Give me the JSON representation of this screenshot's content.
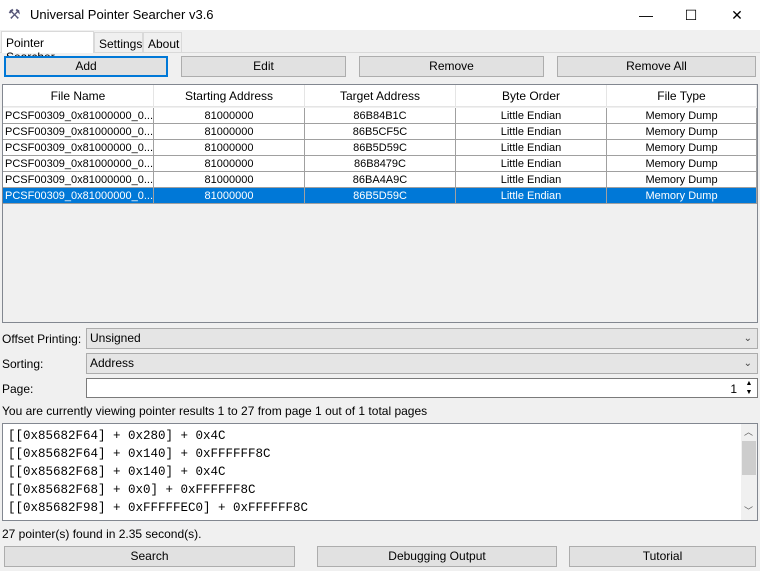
{
  "window": {
    "title": "Universal Pointer Searcher v3.6",
    "minimize": "—",
    "maximize": "☐",
    "close": "✕"
  },
  "tabs": [
    {
      "label": "Pointer Searcher"
    },
    {
      "label": "Settings"
    },
    {
      "label": "About"
    }
  ],
  "toolbar": {
    "add": "Add",
    "edit": "Edit",
    "remove": "Remove",
    "remove_all": "Remove All"
  },
  "table": {
    "columns": [
      "File Name",
      "Starting Address",
      "Target Address",
      "Byte Order",
      "File Type"
    ],
    "rows": [
      [
        "PCSF00309_0x81000000_0...",
        "81000000",
        "86B84B1C",
        "Little Endian",
        "Memory Dump"
      ],
      [
        "PCSF00309_0x81000000_0...",
        "81000000",
        "86B5CF5C",
        "Little Endian",
        "Memory Dump"
      ],
      [
        "PCSF00309_0x81000000_0...",
        "81000000",
        "86B5D59C",
        "Little Endian",
        "Memory Dump"
      ],
      [
        "PCSF00309_0x81000000_0...",
        "81000000",
        "86B8479C",
        "Little Endian",
        "Memory Dump"
      ],
      [
        "PCSF00309_0x81000000_0...",
        "81000000",
        "86BA4A9C",
        "Little Endian",
        "Memory Dump"
      ],
      [
        "PCSF00309_0x81000000_0...",
        "81000000",
        "86B5D59C",
        "Little Endian",
        "Memory Dump"
      ]
    ],
    "selected_row": 5
  },
  "offset_printing": {
    "label": "Offset Printing:",
    "value": "Unsigned"
  },
  "sorting": {
    "label": "Sorting:",
    "value": "Address"
  },
  "page": {
    "label": "Page:",
    "value": "1"
  },
  "page_status": "You are currently viewing pointer results 1 to 27 from page 1 out of 1 total pages",
  "output_lines": [
    "[[0x85682F64] + 0x280] + 0x4C",
    "[[0x85682F64] + 0x140] + 0xFFFFFF8C",
    "[[0x85682F68] + 0x140] + 0x4C",
    "[[0x85682F68] + 0x0] + 0xFFFFFF8C",
    "[[0x85682F98] + 0xFFFFFEC0] + 0xFFFFFF8C"
  ],
  "result_status": "27 pointer(s) found in 2.35 second(s).",
  "bottom": {
    "search": "Search",
    "debug": "Debugging Output",
    "tutorial": "Tutorial"
  }
}
